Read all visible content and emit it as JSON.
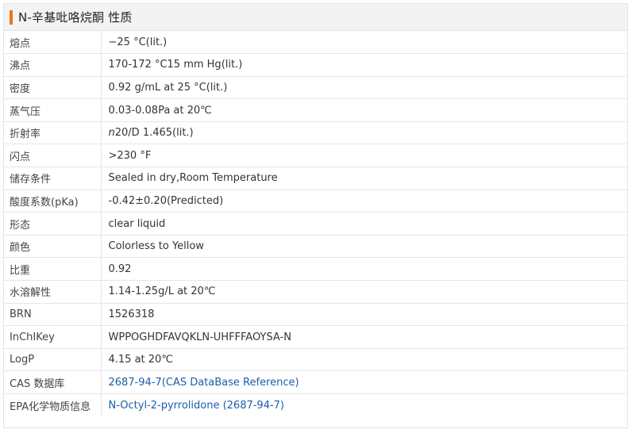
{
  "header": {
    "title": "N-辛基吡咯烷酮 性质",
    "accent_color": "#e8761c"
  },
  "rows": [
    {
      "label": "熔点",
      "value": "−25 °C(lit.)"
    },
    {
      "label": "沸点",
      "value": "170-172 °C15 mm Hg(lit.)"
    },
    {
      "label": "密度",
      "value": "0.92 g/mL at 25 °C(lit.)"
    },
    {
      "label": "蒸气压",
      "value": "0.03-0.08Pa at 20℃"
    },
    {
      "label": "折射率",
      "value_prefix": "n",
      "value": "20/D 1.465(lit.)"
    },
    {
      "label": "闪点",
      "value": ">230 °F"
    },
    {
      "label": "储存条件",
      "value": "Sealed in dry,Room Temperature"
    },
    {
      "label": "酸度系数(pKa)",
      "value": "-0.42±0.20(Predicted)"
    },
    {
      "label": "形态",
      "value": "clear liquid"
    },
    {
      "label": "颜色",
      "value": "Colorless to Yellow"
    },
    {
      "label": "比重",
      "value": "0.92"
    },
    {
      "label": "水溶解性",
      "value": "1.14-1.25g/L at 20℃"
    },
    {
      "label": "BRN",
      "value": "1526318"
    },
    {
      "label": "InChIKey",
      "value": "WPPOGHDFAVQKLN-UHFFFAOYSA-N"
    },
    {
      "label": "LogP",
      "value": "4.15 at 20℃"
    },
    {
      "label": "CAS 数据库",
      "value": "2687-94-7(CAS DataBase Reference)",
      "link": true
    },
    {
      "label": "EPA化学物质信息",
      "value": "N-Octyl-2-pyrrolidone (2687-94-7)",
      "link": true
    }
  ],
  "link_color": "#1a5ea8"
}
